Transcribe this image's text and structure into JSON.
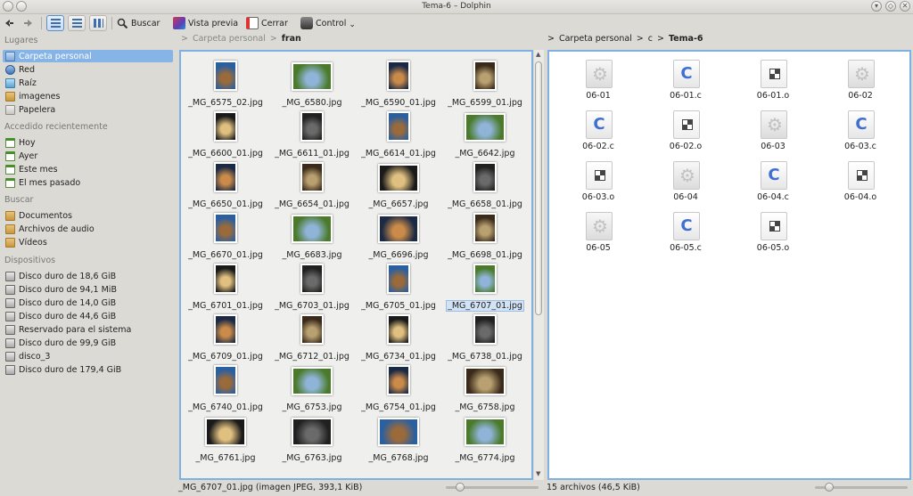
{
  "window": {
    "title": "Tema-6 – Dolphin",
    "minimize_glyph": "▾",
    "maximize_glyph": "◇",
    "close_glyph": "✕"
  },
  "toolbar": {
    "back_icon": "back-arrow-icon",
    "forward_icon": "forward-arrow-icon",
    "search_label": "Buscar",
    "preview_label": "Vista previa",
    "close_label": "Cerrar",
    "control_label": "Control",
    "control_arrow": "⌄"
  },
  "sidebar": {
    "places_header": "Lugares",
    "places": [
      {
        "label": "Carpeta personal",
        "icon": "home",
        "selected": true
      },
      {
        "label": "Red",
        "icon": "net"
      },
      {
        "label": "Raíz",
        "icon": "root"
      },
      {
        "label": "imagenes",
        "icon": "folder"
      },
      {
        "label": "Papelera",
        "icon": "trash"
      }
    ],
    "recent_header": "Accedido recientemente",
    "recent": [
      {
        "label": "Hoy",
        "icon": "cal"
      },
      {
        "label": "Ayer",
        "icon": "cal"
      },
      {
        "label": "Este mes",
        "icon": "cal"
      },
      {
        "label": "El mes pasado",
        "icon": "cal"
      }
    ],
    "search_header": "Buscar",
    "search": [
      {
        "label": "Documentos",
        "icon": "folder"
      },
      {
        "label": "Archivos de audio",
        "icon": "folder"
      },
      {
        "label": "Vídeos",
        "icon": "folder"
      }
    ],
    "devices_header": "Dispositivos",
    "devices": [
      {
        "label": "Disco duro de 18,6 GiB"
      },
      {
        "label": "Disco duro de 94,1 MiB"
      },
      {
        "label": "Disco duro de 14,0 GiB"
      },
      {
        "label": "Disco duro de 44,6 GiB"
      },
      {
        "label": "Reservado para el sistema"
      },
      {
        "label": "Disco duro de 99,9 GiB"
      },
      {
        "label": "disco_3"
      },
      {
        "label": "Disco duro de 179,4 GiB"
      }
    ]
  },
  "left_pane": {
    "breadcrumb": [
      ">",
      "Carpeta personal",
      ">",
      "fran"
    ],
    "files": [
      "_MG_6575_02.jpg",
      "_MG_6580.jpg",
      "_MG_6590_01.jpg",
      "_MG_6599_01.jpg",
      "_MG_6600_01.jpg",
      "_MG_6611_01.jpg",
      "_MG_6614_01.jpg",
      "_MG_6642.jpg",
      "_MG_6650_01.jpg",
      "_MG_6654_01.jpg",
      "_MG_6657.jpg",
      "_MG_6658_01.jpg",
      "_MG_6670_01.jpg",
      "_MG_6683.jpg",
      "_MG_6696.jpg",
      "_MG_6698_01.jpg",
      "_MG_6701_01.jpg",
      "_MG_6703_01.jpg",
      "_MG_6705_01.jpg",
      "_MG_6707_01.jpg",
      "_MG_6709_01.jpg",
      "_MG_6712_01.jpg",
      "_MG_6734_01.jpg",
      "_MG_6738_01.jpg",
      "_MG_6740_01.jpg",
      "_MG_6753.jpg",
      "_MG_6754_01.jpg",
      "_MG_6758.jpg",
      "_MG_6761.jpg",
      "_MG_6763.jpg",
      "_MG_6768.jpg",
      "_MG_6774.jpg"
    ],
    "selected_file": "_MG_6707_01.jpg",
    "status": "_MG_6707_01.jpg (imagen JPEG, 393,1 KiB)"
  },
  "right_pane": {
    "breadcrumb": [
      ">",
      "Carpeta personal",
      ">",
      "c",
      ">",
      "Tema-6"
    ],
    "files": [
      {
        "name": "06-01",
        "type": "gear"
      },
      {
        "name": "06-01.c",
        "type": "csrc"
      },
      {
        "name": "06-01.o",
        "type": "obj"
      },
      {
        "name": "06-02",
        "type": "gear"
      },
      {
        "name": "06-02.c",
        "type": "csrc"
      },
      {
        "name": "06-02.o",
        "type": "obj"
      },
      {
        "name": "06-03",
        "type": "gear"
      },
      {
        "name": "06-03.c",
        "type": "csrc"
      },
      {
        "name": "06-03.o",
        "type": "obj"
      },
      {
        "name": "06-04",
        "type": "gear"
      },
      {
        "name": "06-04.c",
        "type": "csrc"
      },
      {
        "name": "06-04.o",
        "type": "obj"
      },
      {
        "name": "06-05",
        "type": "gear"
      },
      {
        "name": "06-05.c",
        "type": "csrc"
      },
      {
        "name": "06-05.o",
        "type": "obj"
      }
    ],
    "status": "15 archivos (46,5 KiB)"
  },
  "zoom": {
    "left": 0.15,
    "right": 0.15
  }
}
